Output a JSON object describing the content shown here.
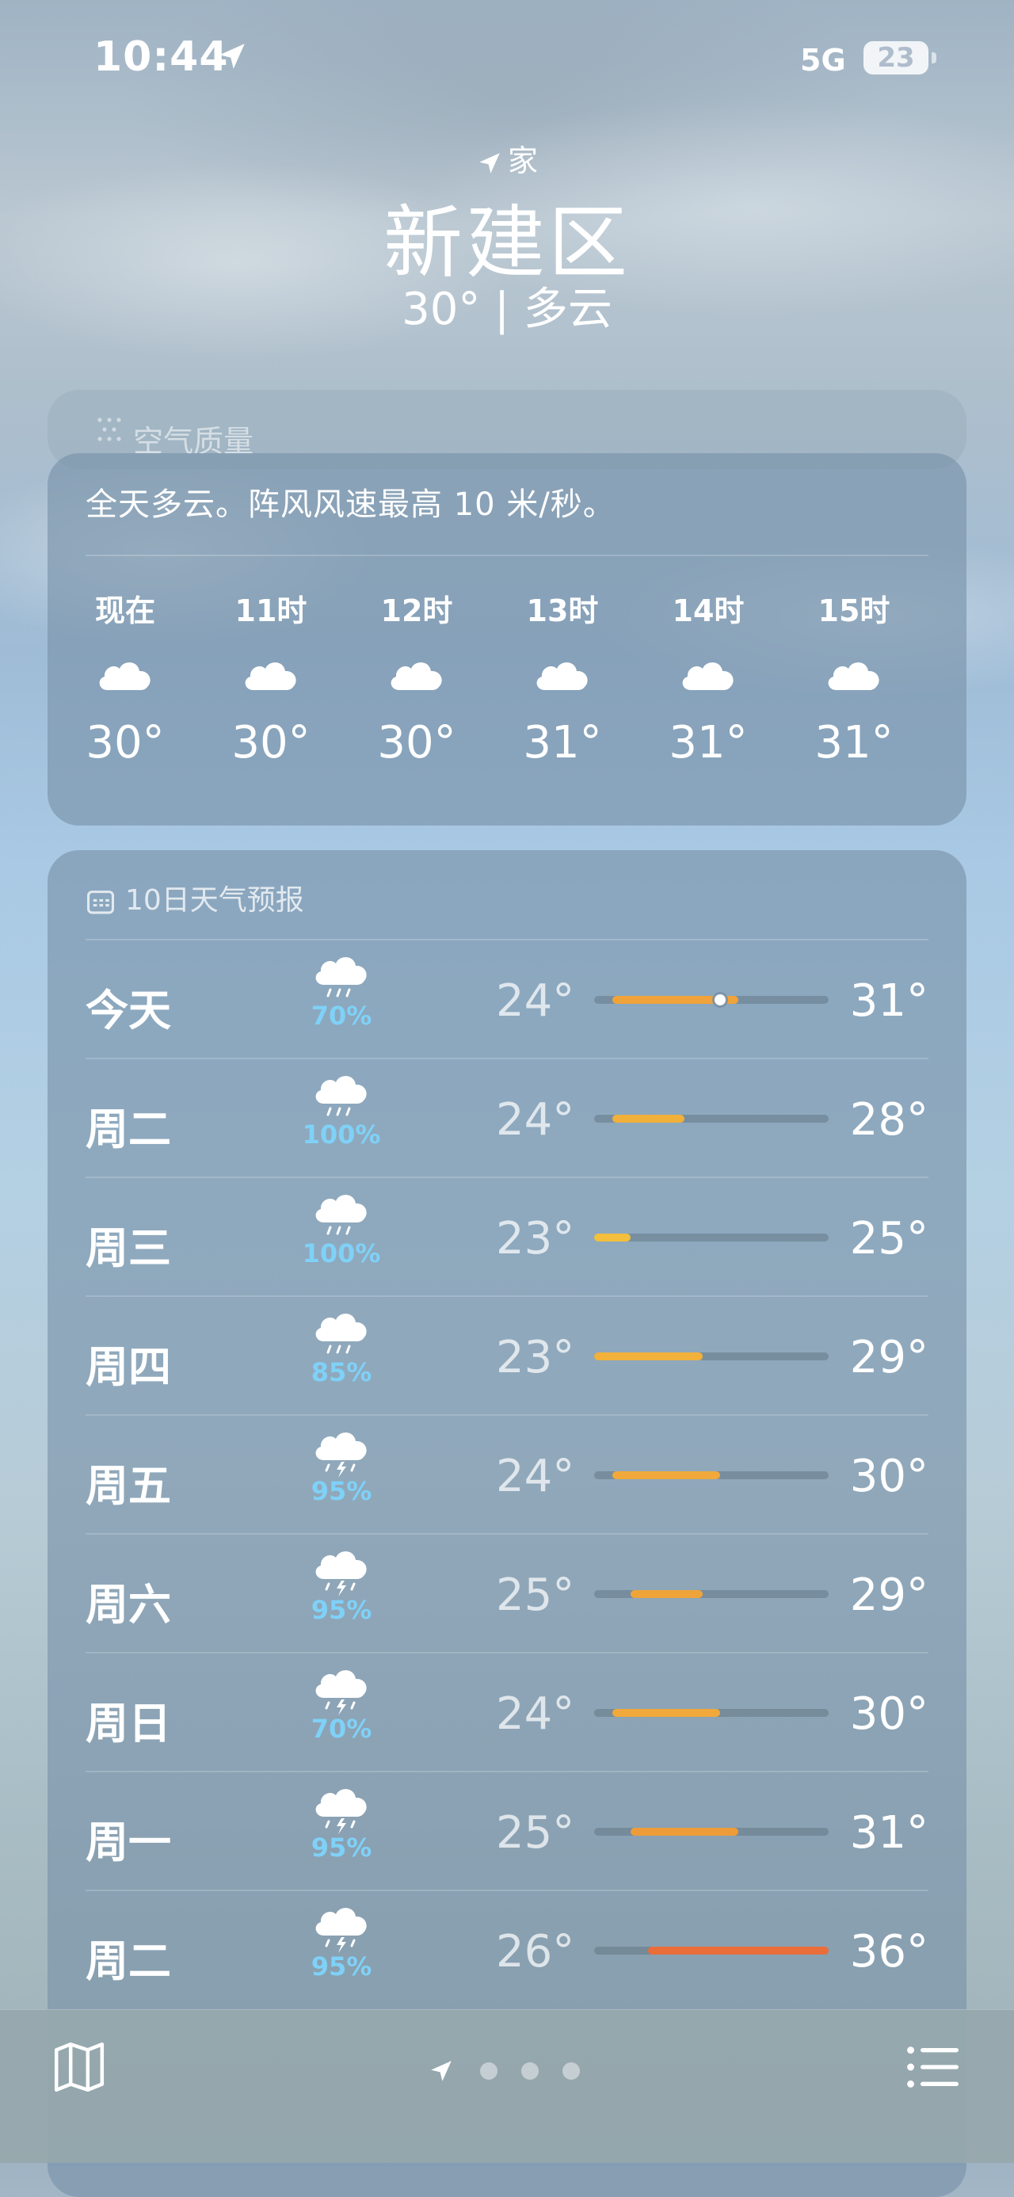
{
  "status_bar": {
    "time": "10:44",
    "network": "5G",
    "battery": "23"
  },
  "location": {
    "tag": "家",
    "city": "新建区",
    "current": "30° | 多云"
  },
  "air_quality": {
    "label": "空气质量"
  },
  "hourly": {
    "summary": "全天多云。阵风风速最高 10 米/秒。",
    "items": [
      {
        "label": "现在",
        "icon": "cloud-icon",
        "temp": "30°"
      },
      {
        "label": "11时",
        "icon": "cloud-icon",
        "temp": "30°"
      },
      {
        "label": "12时",
        "icon": "cloud-icon",
        "temp": "30°"
      },
      {
        "label": "13时",
        "icon": "cloud-icon",
        "temp": "31°"
      },
      {
        "label": "14时",
        "icon": "cloud-icon",
        "temp": "31°"
      },
      {
        "label": "15时",
        "icon": "cloud-icon",
        "temp": "31°"
      }
    ]
  },
  "daily": {
    "title": "10日天气预报",
    "scale": {
      "min": 23,
      "max": 36
    },
    "days": [
      {
        "day": "今天",
        "icon": "cloud-rain-icon",
        "precip": "70%",
        "low": "24°",
        "high": "31°",
        "low_v": 24,
        "high_v": 31,
        "current_v": 30,
        "color": "#f0a33a"
      },
      {
        "day": "周二",
        "icon": "cloud-rain-icon",
        "precip": "100%",
        "low": "24°",
        "high": "28°",
        "low_v": 24,
        "high_v": 28,
        "color": "#f0b03a"
      },
      {
        "day": "周三",
        "icon": "cloud-rain-icon",
        "precip": "100%",
        "low": "23°",
        "high": "25°",
        "low_v": 23,
        "high_v": 25,
        "color": "#f3bf3c"
      },
      {
        "day": "周四",
        "icon": "cloud-rain-icon",
        "precip": "85%",
        "low": "23°",
        "high": "29°",
        "low_v": 23,
        "high_v": 29,
        "color": "#f2b13a"
      },
      {
        "day": "周五",
        "icon": "cloud-bolt-icon",
        "precip": "95%",
        "low": "24°",
        "high": "30°",
        "low_v": 24,
        "high_v": 30,
        "color": "#f0a93a"
      },
      {
        "day": "周六",
        "icon": "cloud-bolt-icon",
        "precip": "95%",
        "low": "25°",
        "high": "29°",
        "low_v": 25,
        "high_v": 29,
        "color": "#efa43a"
      },
      {
        "day": "周日",
        "icon": "cloud-bolt-icon",
        "precip": "70%",
        "low": "24°",
        "high": "30°",
        "low_v": 24,
        "high_v": 30,
        "color": "#f0a93a"
      },
      {
        "day": "周一",
        "icon": "cloud-bolt-icon",
        "precip": "95%",
        "low": "25°",
        "high": "31°",
        "low_v": 25,
        "high_v": 31,
        "color": "#ee9c3a"
      },
      {
        "day": "周二",
        "icon": "cloud-bolt-icon",
        "precip": "95%",
        "low": "26°",
        "high": "36°",
        "low_v": 26,
        "high_v": 36,
        "color": "#ea6e3a"
      }
    ]
  },
  "bottom_bar": {
    "map_icon": "map-icon",
    "location_icon": "location-arrow-icon",
    "page_count": 3,
    "list_icon": "list-icon"
  }
}
